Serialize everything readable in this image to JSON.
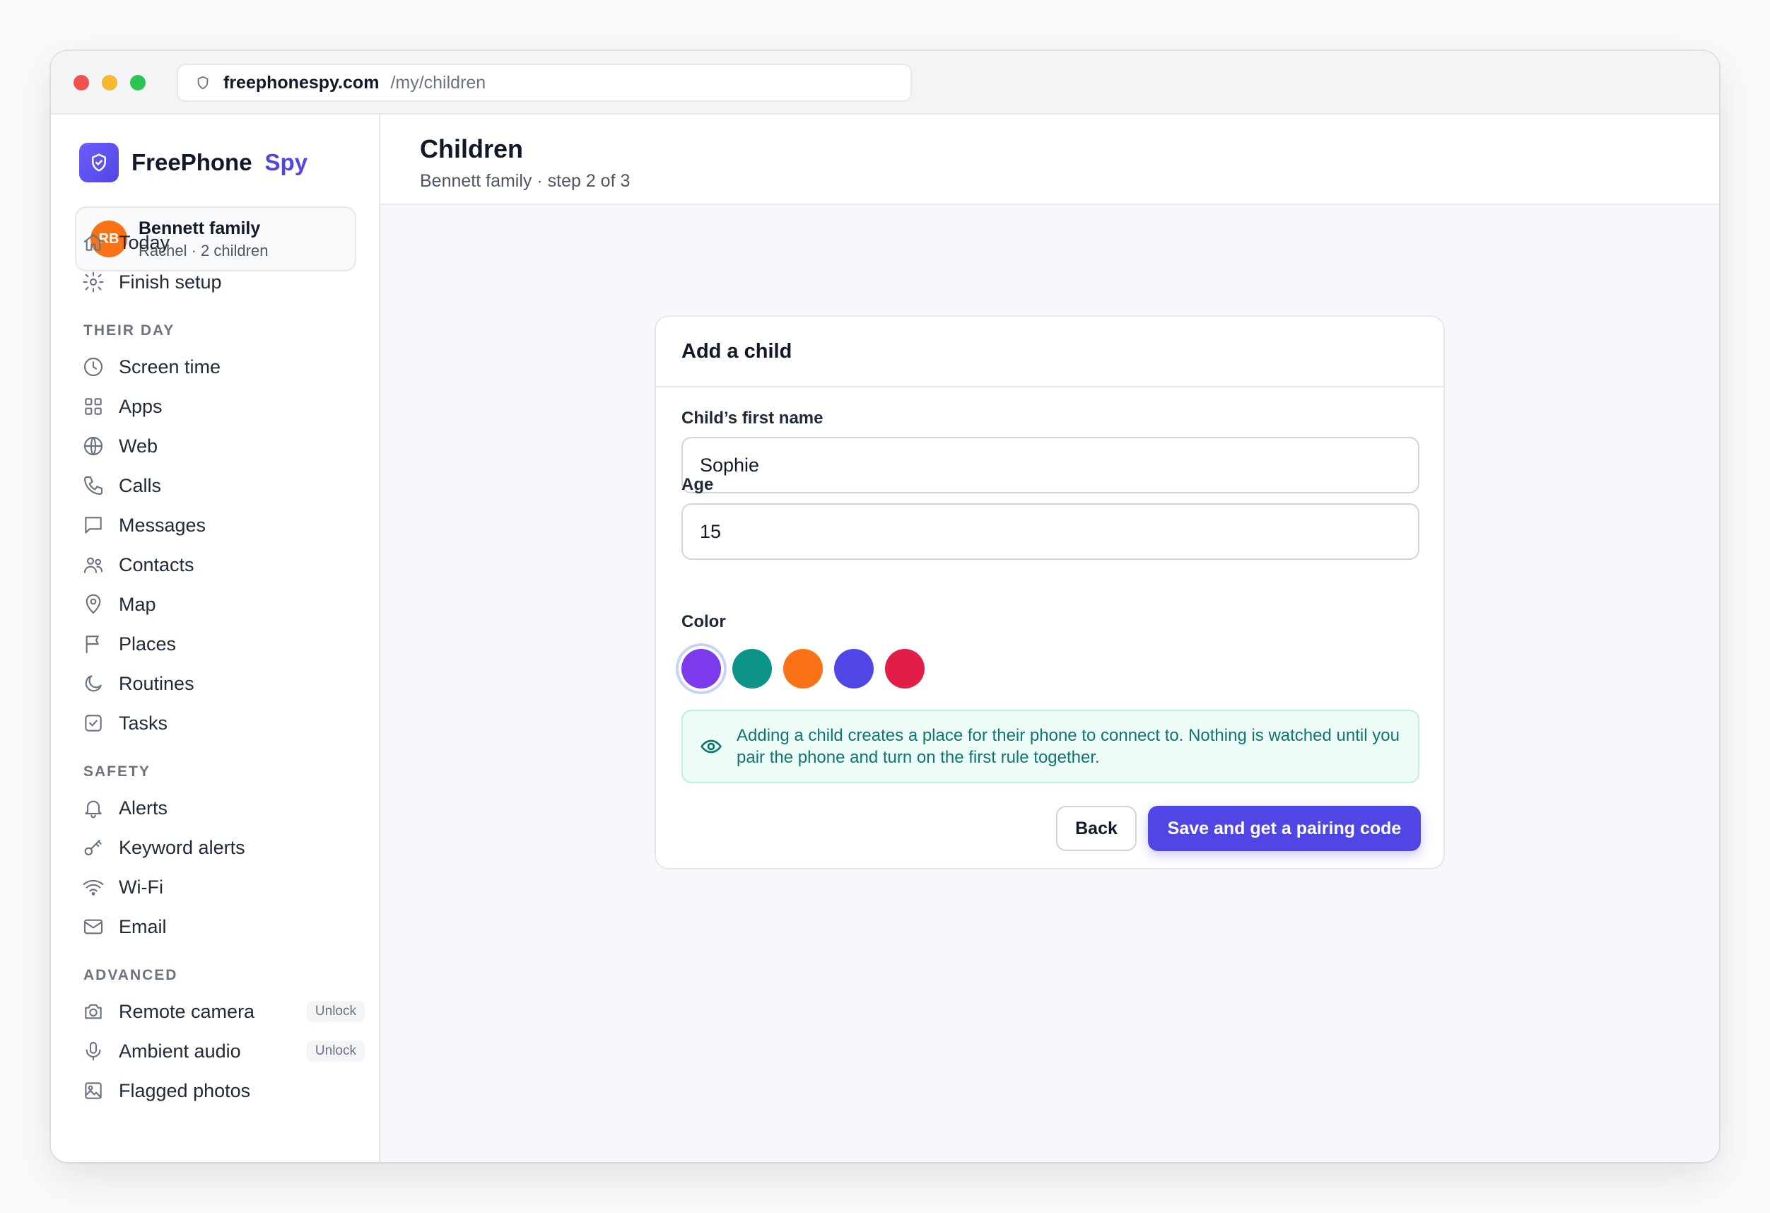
{
  "browser": {
    "url_domain": "freephonespy.com",
    "url_path": "/my/children"
  },
  "brand": {
    "name": "FreePhone",
    "accent": "Spy",
    "logo_icon": "shield-check-icon"
  },
  "family": {
    "initials": "RB",
    "name": "Bennett family",
    "subtitle": "Rachel · 2 children"
  },
  "nav": {
    "top": [
      {
        "label": "Today",
        "icon": "home-icon"
      },
      {
        "label": "Finish setup",
        "icon": "gear-icon"
      }
    ],
    "sections": [
      {
        "title": "THEIR DAY",
        "items": [
          {
            "label": "Screen time",
            "icon": "clock-icon"
          },
          {
            "label": "Apps",
            "icon": "grid-icon"
          },
          {
            "label": "Web",
            "icon": "globe-icon"
          },
          {
            "label": "Calls",
            "icon": "phone-icon"
          },
          {
            "label": "Messages",
            "icon": "message-icon"
          },
          {
            "label": "Contacts",
            "icon": "users-icon"
          },
          {
            "label": "Map",
            "icon": "map-pin-icon"
          },
          {
            "label": "Places",
            "icon": "flag-icon"
          },
          {
            "label": "Routines",
            "icon": "moon-icon"
          },
          {
            "label": "Tasks",
            "icon": "checkbox-icon"
          }
        ]
      },
      {
        "title": "SAFETY",
        "items": [
          {
            "label": "Alerts",
            "icon": "bell-icon"
          },
          {
            "label": "Keyword alerts",
            "icon": "key-icon"
          },
          {
            "label": "Wi-Fi",
            "icon": "wifi-icon"
          },
          {
            "label": "Email",
            "icon": "mail-icon"
          }
        ]
      },
      {
        "title": "ADVANCED",
        "items": [
          {
            "label": "Remote camera",
            "icon": "camera-icon",
            "badge": "Unlock"
          },
          {
            "label": "Ambient audio",
            "icon": "microphone-icon",
            "badge": "Unlock"
          },
          {
            "label": "Flagged photos",
            "icon": "image-icon"
          }
        ]
      }
    ]
  },
  "header": {
    "title": "Children",
    "subtitle": "Bennett family · step 2 of 3"
  },
  "form": {
    "title": "Add a child",
    "name_label": "Child’s first name",
    "name_value": "Sophie",
    "age_label": "Age",
    "age_value": "15",
    "color_label": "Color",
    "colors": [
      "#7c3aed",
      "#0d9488",
      "#f97316",
      "#4f46e5",
      "#e11d48"
    ],
    "selected_color": 0,
    "notice_icon": "eye-icon",
    "notice": "Adding a child creates a place for their phone to connect to. Nothing is watched until you pair the phone and turn on the first rule together.",
    "back_label": "Back",
    "submit_label": "Save and get a pairing code"
  },
  "theme": {
    "accent": "#4f46e5",
    "avatar": "#f97316"
  }
}
